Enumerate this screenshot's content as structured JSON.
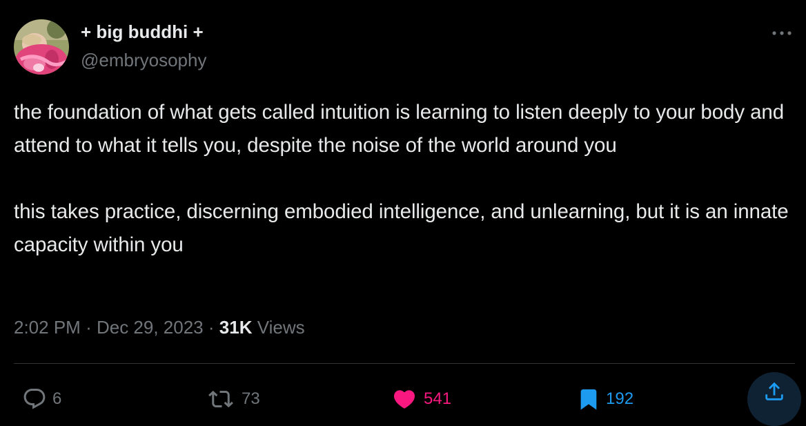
{
  "author": {
    "display_name": "+ big buddhi +",
    "handle": "@embryosophy",
    "avatar_icon": "profile-photo"
  },
  "tweet": {
    "paragraphs": [
      "the foundation of what gets called intuition is learning to listen deeply to your body and attend to what it tells you, despite the noise of the world around you",
      "this takes practice, discerning embodied intelligence, and unlearning, but it is an innate capacity within you"
    ],
    "time": "2:02 PM",
    "date": "Dec 29, 2023",
    "separator": "·",
    "views_count": "31K",
    "views_label": "Views"
  },
  "actions": {
    "reply": {
      "icon": "reply-icon",
      "count": "6"
    },
    "retweet": {
      "icon": "retweet-icon",
      "count": "73"
    },
    "like": {
      "icon": "heart-icon",
      "count": "541"
    },
    "bookmark": {
      "icon": "bookmark-icon",
      "count": "192"
    },
    "share": {
      "icon": "share-icon"
    },
    "more": {
      "icon": "more-icon"
    }
  },
  "colors": {
    "background": "#000000",
    "text_primary": "#e7e9ea",
    "text_secondary": "#71767b",
    "like": "#f91880",
    "bookmark": "#1d9bf0",
    "divider": "#2f3336"
  }
}
